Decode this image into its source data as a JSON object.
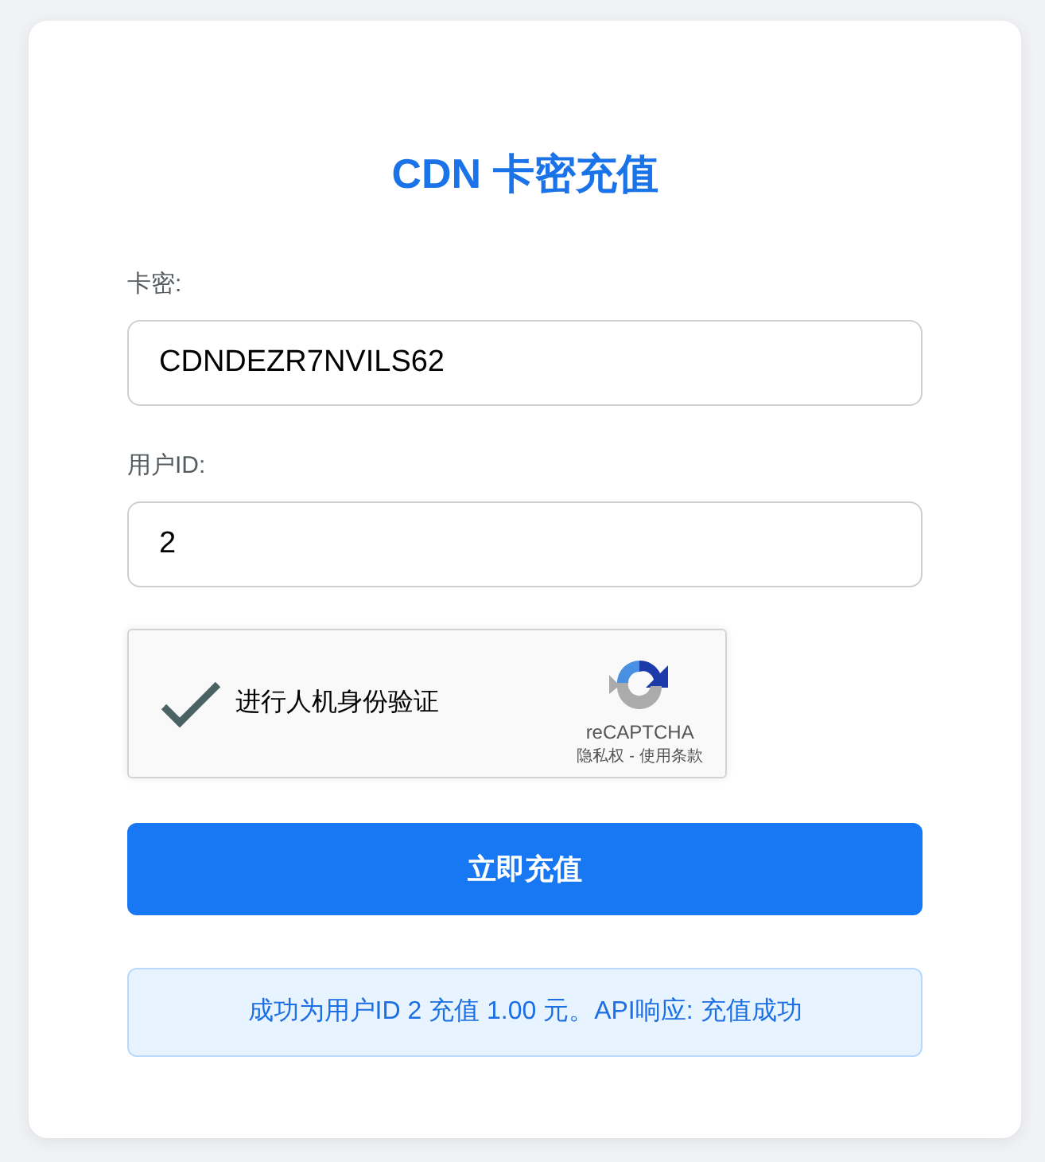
{
  "title": "CDN 卡密充值",
  "fields": [
    {
      "label": "卡密:",
      "value": "CDNDEZR7NVILS62"
    },
    {
      "label": "用户ID:",
      "value": "2"
    }
  ],
  "captcha": {
    "checked": true,
    "label": "进行人机身份验证",
    "brand": "reCAPTCHA",
    "privacy_link": "隐私权",
    "separator": "-",
    "terms_link": "使用条款"
  },
  "submit_button": "立即充值",
  "message": {
    "kind": "success",
    "text": "成功为用户ID 2 充值 1.00 元。API响应: 充值成功"
  }
}
